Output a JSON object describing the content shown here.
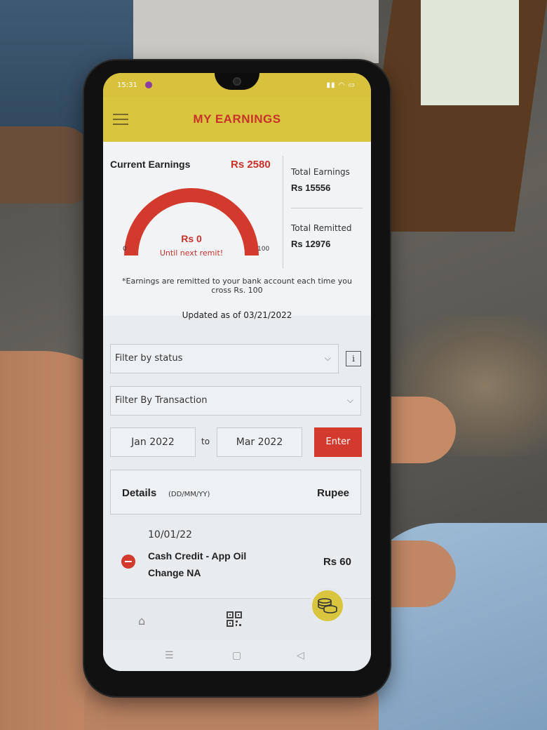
{
  "status_bar": {
    "time": "15:31",
    "icons": "▮▮ ◠ ▭"
  },
  "header": {
    "title": "MY EARNINGS"
  },
  "earnings": {
    "current_label": "Current Earnings",
    "current_value": "Rs 2580",
    "total_earnings_label": "Total Earnings",
    "total_earnings_value": "Rs 15556",
    "total_remitted_label": "Total Remitted",
    "total_remitted_value": "Rs 12976",
    "gauge": {
      "min": "0",
      "max": "100",
      "value": "Rs 0",
      "caption": "Until next remit!",
      "fraction": 0,
      "color": "#d23a2e"
    },
    "note": "*Earnings are remitted to your bank account each time you cross Rs. 100",
    "updated": "Updated as of 03/21/2022"
  },
  "filters": {
    "status_label": "Filter by status",
    "transaction_label": "Filter By Transaction",
    "info_label": "i",
    "date_from": "Jan 2022",
    "to_label": "to",
    "date_to": "Mar 2022",
    "enter_label": "Enter"
  },
  "details": {
    "title": "Details",
    "subtitle": "(DD/MM/YY)",
    "rupee_label": "Rupee",
    "transactions": [
      {
        "date": "10/01/22",
        "description": "Cash Credit - App Oil Change NA",
        "amount": "Rs 60",
        "icon": "minus-circle-icon"
      }
    ]
  },
  "nav": {
    "home_icon": "home-icon",
    "qr_icon": "qr-code-icon",
    "coins_icon": "coins-icon"
  },
  "colors": {
    "accent": "#d23a2e",
    "header_bg": "#d9c53e"
  }
}
